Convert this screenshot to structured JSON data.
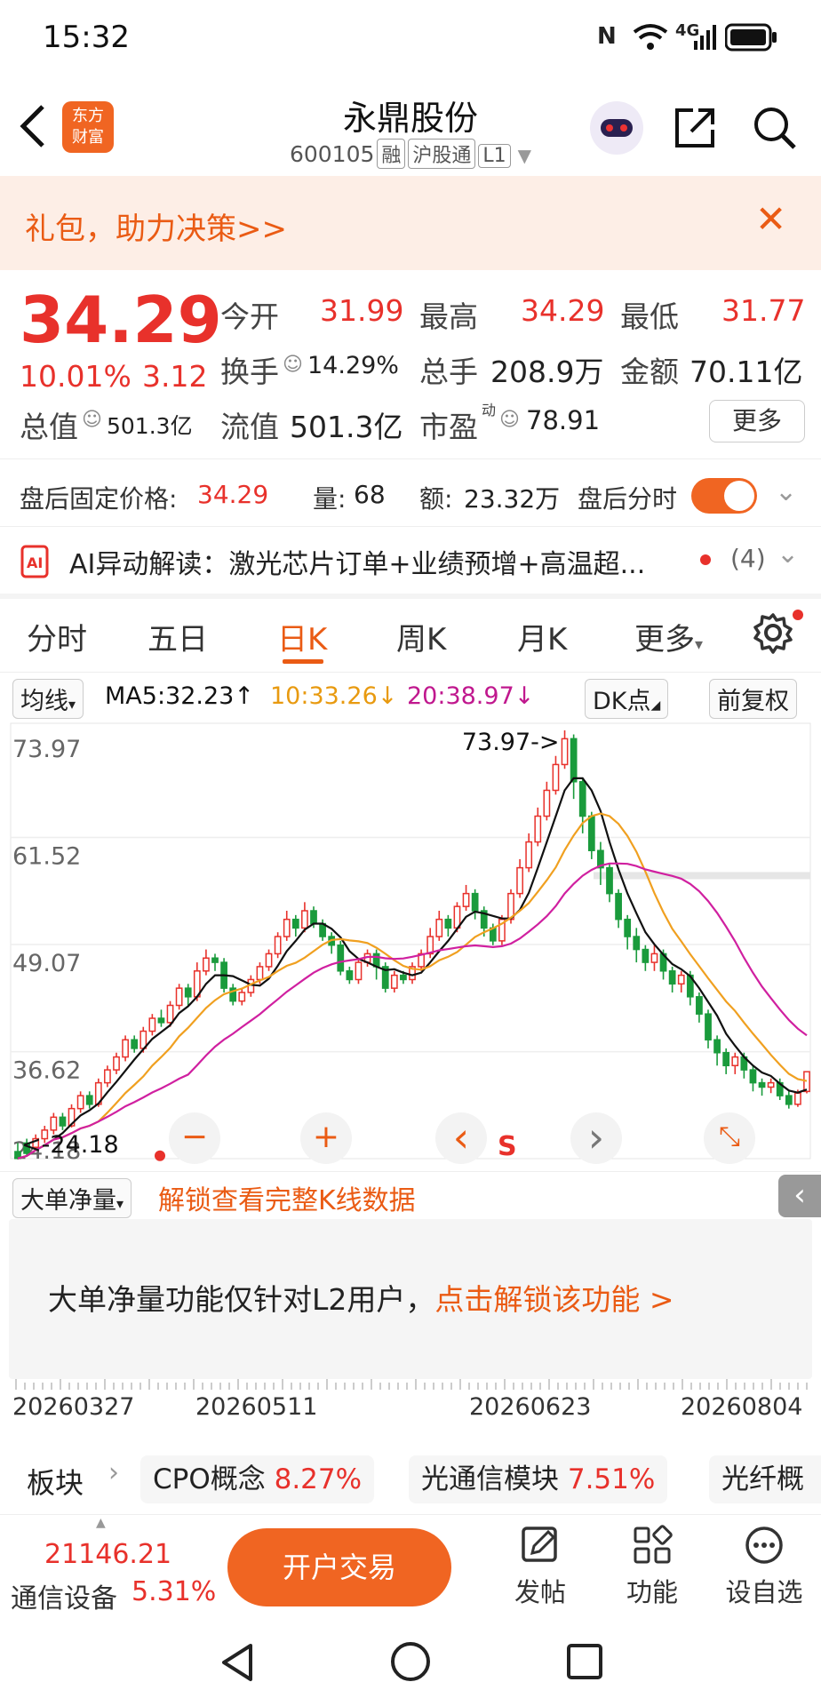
{
  "status_bar": {
    "time": "15:32",
    "network": "4G"
  },
  "header": {
    "title": "永鼎股份",
    "code": "600105",
    "tags": [
      "融",
      "沪股通",
      "L1"
    ],
    "logo_line1": "东方",
    "logo_line2": "财富"
  },
  "banner": {
    "text": "礼包，助力决策>>"
  },
  "quote": {
    "price": "34.29",
    "change_pct": "10.01%",
    "change": "3.12",
    "open_label": "今开",
    "open": "31.99",
    "high_label": "最高",
    "high": "34.29",
    "low_label": "最低",
    "low": "31.77",
    "turnover_label": "换手",
    "turnover": "14.29%",
    "volume_label": "总手",
    "volume": "208.9万",
    "amount_label": "金额",
    "amount": "70.11亿",
    "mcap_label": "总值",
    "mcap": "501.3亿",
    "float_label": "流值",
    "float": "501.3亿",
    "pe_label": "市盈",
    "pe_sup": "动",
    "pe": "78.91",
    "more": "更多"
  },
  "after_hours": {
    "label": "盘后固定价格:",
    "price": "34.29",
    "vol_label": "量:",
    "vol": "68",
    "amt_label": "额:",
    "amt": "23.32万",
    "switch_label": "盘后分时"
  },
  "ai": {
    "text": "AI异动解读：激光芯片订单+业绩预增+高温超...",
    "count": "(4)"
  },
  "tabs": [
    "分时",
    "五日",
    "日K",
    "周K",
    "月K",
    "更多"
  ],
  "ma": {
    "select": "均线",
    "ma5": "MA5:32.23↑",
    "ma10": "10:33.26↓",
    "ma20": "20:38.97↓",
    "dk": "DK点",
    "adjust": "前复权"
  },
  "colors": {
    "accent": "#ea5b14",
    "up": "#e8312b",
    "down": "#1a9b3c",
    "ma5": "#111111",
    "ma10": "#f0a020",
    "ma20": "#d020a0"
  },
  "chart_data": {
    "type": "candlestick",
    "y_ticks": [
      "73.97",
      "61.52",
      "49.07",
      "36.62",
      "24.18"
    ],
    "ylim": [
      24.18,
      73.97
    ],
    "x_labels": [
      "20260327",
      "20260511",
      "20260623",
      "20260804"
    ],
    "high_label": "73.97->",
    "low_label": "<-24.18",
    "s_marker": "S",
    "candles": [
      [
        25,
        24.2,
        26,
        24.1
      ],
      [
        26,
        24.8,
        26.5,
        24.5
      ],
      [
        25.5,
        26.5,
        27,
        25.2
      ],
      [
        26.5,
        27.5,
        28,
        26
      ],
      [
        27.5,
        29,
        29.5,
        27
      ],
      [
        29,
        28,
        29.5,
        27.5
      ],
      [
        28,
        30,
        30.5,
        27.8
      ],
      [
        30,
        31.5,
        32,
        29.5
      ],
      [
        31.5,
        30.5,
        32,
        30
      ],
      [
        30.5,
        33,
        33.5,
        30.2
      ],
      [
        33,
        34.5,
        35,
        32.5
      ],
      [
        34.5,
        36,
        36.5,
        34
      ],
      [
        36,
        38,
        38.5,
        35.5
      ],
      [
        38,
        37,
        38.5,
        36.5
      ],
      [
        37,
        39,
        39.5,
        36.5
      ],
      [
        39,
        40.5,
        41,
        38.5
      ],
      [
        40.5,
        40,
        41.5,
        39.5
      ],
      [
        40,
        42,
        42.5,
        39.5
      ],
      [
        42,
        44,
        44.5,
        41.5
      ],
      [
        44,
        43,
        44.5,
        42
      ],
      [
        43,
        46,
        47,
        42.5
      ],
      [
        46,
        47.5,
        48.5,
        45.5
      ],
      [
        47.5,
        47,
        48,
        46
      ],
      [
        47,
        44,
        47.5,
        43.5
      ],
      [
        44,
        42.5,
        44.5,
        42
      ],
      [
        42.5,
        43.5,
        44,
        42
      ],
      [
        43.5,
        45,
        45.5,
        43
      ],
      [
        45,
        46.5,
        47,
        44.5
      ],
      [
        46.5,
        48,
        48.5,
        46
      ],
      [
        48,
        50,
        50.5,
        47.5
      ],
      [
        50,
        52,
        53,
        49.5
      ],
      [
        52,
        51,
        52.5,
        50
      ],
      [
        51,
        53,
        54,
        50.5
      ],
      [
        53,
        51.5,
        53.5,
        51
      ],
      [
        51.5,
        50,
        52,
        49.5
      ],
      [
        50,
        49,
        50.5,
        48
      ],
      [
        49,
        46,
        49.5,
        45.5
      ],
      [
        46,
        45,
        46.5,
        44.5
      ],
      [
        45,
        47,
        47.5,
        44.5
      ],
      [
        47,
        48,
        48.5,
        46.5
      ],
      [
        48,
        46.5,
        48.5,
        45
      ],
      [
        46.5,
        44,
        47,
        43.5
      ],
      [
        44,
        45.5,
        46,
        43.5
      ],
      [
        45.5,
        45,
        46,
        44.5
      ],
      [
        45,
        46.5,
        47,
        44.5
      ],
      [
        46.5,
        48,
        48.5,
        46
      ],
      [
        48,
        50,
        51,
        47.5
      ],
      [
        50,
        52,
        53,
        49.5
      ],
      [
        52,
        51,
        52.5,
        50
      ],
      [
        51,
        53.5,
        54,
        50.5
      ],
      [
        53.5,
        55,
        56,
        53
      ],
      [
        55,
        53,
        55.5,
        52
      ],
      [
        53,
        51,
        53.5,
        50
      ],
      [
        51,
        49.5,
        51.5,
        49
      ],
      [
        49.5,
        52,
        52.5,
        49
      ],
      [
        52,
        55,
        55.5,
        51.5
      ],
      [
        55,
        58,
        59,
        54.5
      ],
      [
        58,
        61,
        62,
        57.5
      ],
      [
        61,
        64,
        65,
        60.5
      ],
      [
        64,
        67,
        68,
        63.5
      ],
      [
        67,
        70,
        71,
        66.5
      ],
      [
        70,
        73,
        73.97,
        69.5
      ],
      [
        73,
        68,
        73.5,
        66
      ],
      [
        68,
        64,
        68.5,
        62
      ],
      [
        64,
        60,
        64.5,
        59
      ],
      [
        60,
        58,
        61,
        56
      ],
      [
        58,
        55,
        58.5,
        54
      ],
      [
        55,
        52,
        55.5,
        51
      ],
      [
        52,
        50,
        52.5,
        48.5
      ],
      [
        50,
        48.5,
        51,
        47
      ],
      [
        48.5,
        47,
        49,
        46
      ],
      [
        47,
        48,
        49,
        46
      ],
      [
        48,
        46,
        48.5,
        45
      ],
      [
        46,
        44.5,
        46.5,
        43.5
      ],
      [
        44.5,
        45.5,
        46,
        43.5
      ],
      [
        45.5,
        43,
        46,
        42
      ],
      [
        43,
        41,
        43.5,
        40
      ],
      [
        41,
        38,
        41.5,
        37
      ],
      [
        38,
        36.5,
        38.5,
        35
      ],
      [
        36.5,
        35,
        37,
        34
      ],
      [
        35,
        36,
        36.5,
        34
      ],
      [
        36,
        34.5,
        36.5,
        33.5
      ],
      [
        34.5,
        33,
        35,
        32
      ],
      [
        33,
        32.5,
        33.5,
        31.5
      ],
      [
        32.5,
        33,
        33.5,
        31.8
      ],
      [
        33,
        31.5,
        33.5,
        31
      ],
      [
        31.5,
        30.5,
        32,
        30
      ],
      [
        30.5,
        31.8,
        32.2,
        30.2
      ],
      [
        31.99,
        34.29,
        34.29,
        31.77
      ]
    ]
  },
  "chart_controls": {
    "minus": "−",
    "plus": "+",
    "prev": "‹",
    "next": "›",
    "expand": "⤡"
  },
  "lower": {
    "select": "大单净量",
    "unlock_link": "解锁查看完整K线数据",
    "notice": "大单净量功能仅针对L2用户，",
    "notice_link": "点击解锁该功能 >"
  },
  "sectors": {
    "label": "板块",
    "items": [
      {
        "name": "CPO概念",
        "pct": "8.27%"
      },
      {
        "name": "光通信模块",
        "pct": "7.51%"
      },
      {
        "name": "光纤概",
        "pct": ""
      }
    ]
  },
  "bottom": {
    "index_value": "21146.21",
    "index_name": "通信设备",
    "index_pct": "5.31%",
    "trade": "开户交易",
    "post": "发帖",
    "functions": "功能",
    "watch": "设自选"
  }
}
